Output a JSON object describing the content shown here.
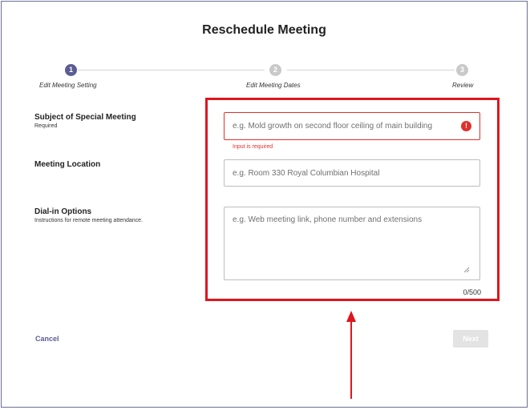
{
  "dialog": {
    "title": "Reschedule Meeting"
  },
  "stepper": {
    "steps": [
      {
        "number": "1",
        "label": "Edit Meeting Setting",
        "state": "active"
      },
      {
        "number": "2",
        "label": "Edit Meeting Dates",
        "state": "inactive"
      },
      {
        "number": "3",
        "label": "Review",
        "state": "inactive"
      }
    ]
  },
  "form": {
    "subject": {
      "label": "Subject of Special Meeting",
      "sublabel": "Required",
      "placeholder": "e.g. Mold growth on second floor ceiling of main building",
      "value": "",
      "error": "Input is required",
      "error_icon": "exclamation-icon"
    },
    "location": {
      "label": "Meeting Location",
      "placeholder": "e.g. Room 330 Royal Columbian Hospital",
      "value": ""
    },
    "dial_in": {
      "label": "Dial-in Options",
      "sublabel": "Instructions for remote meeting attendance.",
      "placeholder": "e.g. Web meeting link, phone number and extensions",
      "value": "",
      "counter": "0/500"
    }
  },
  "actions": {
    "cancel_label": "Cancel",
    "next_label": "Next"
  },
  "colors": {
    "accent": "#5b5c94",
    "error": "#e0302b",
    "annotation": "#e0151d",
    "disabled": "#e3e3e3"
  }
}
